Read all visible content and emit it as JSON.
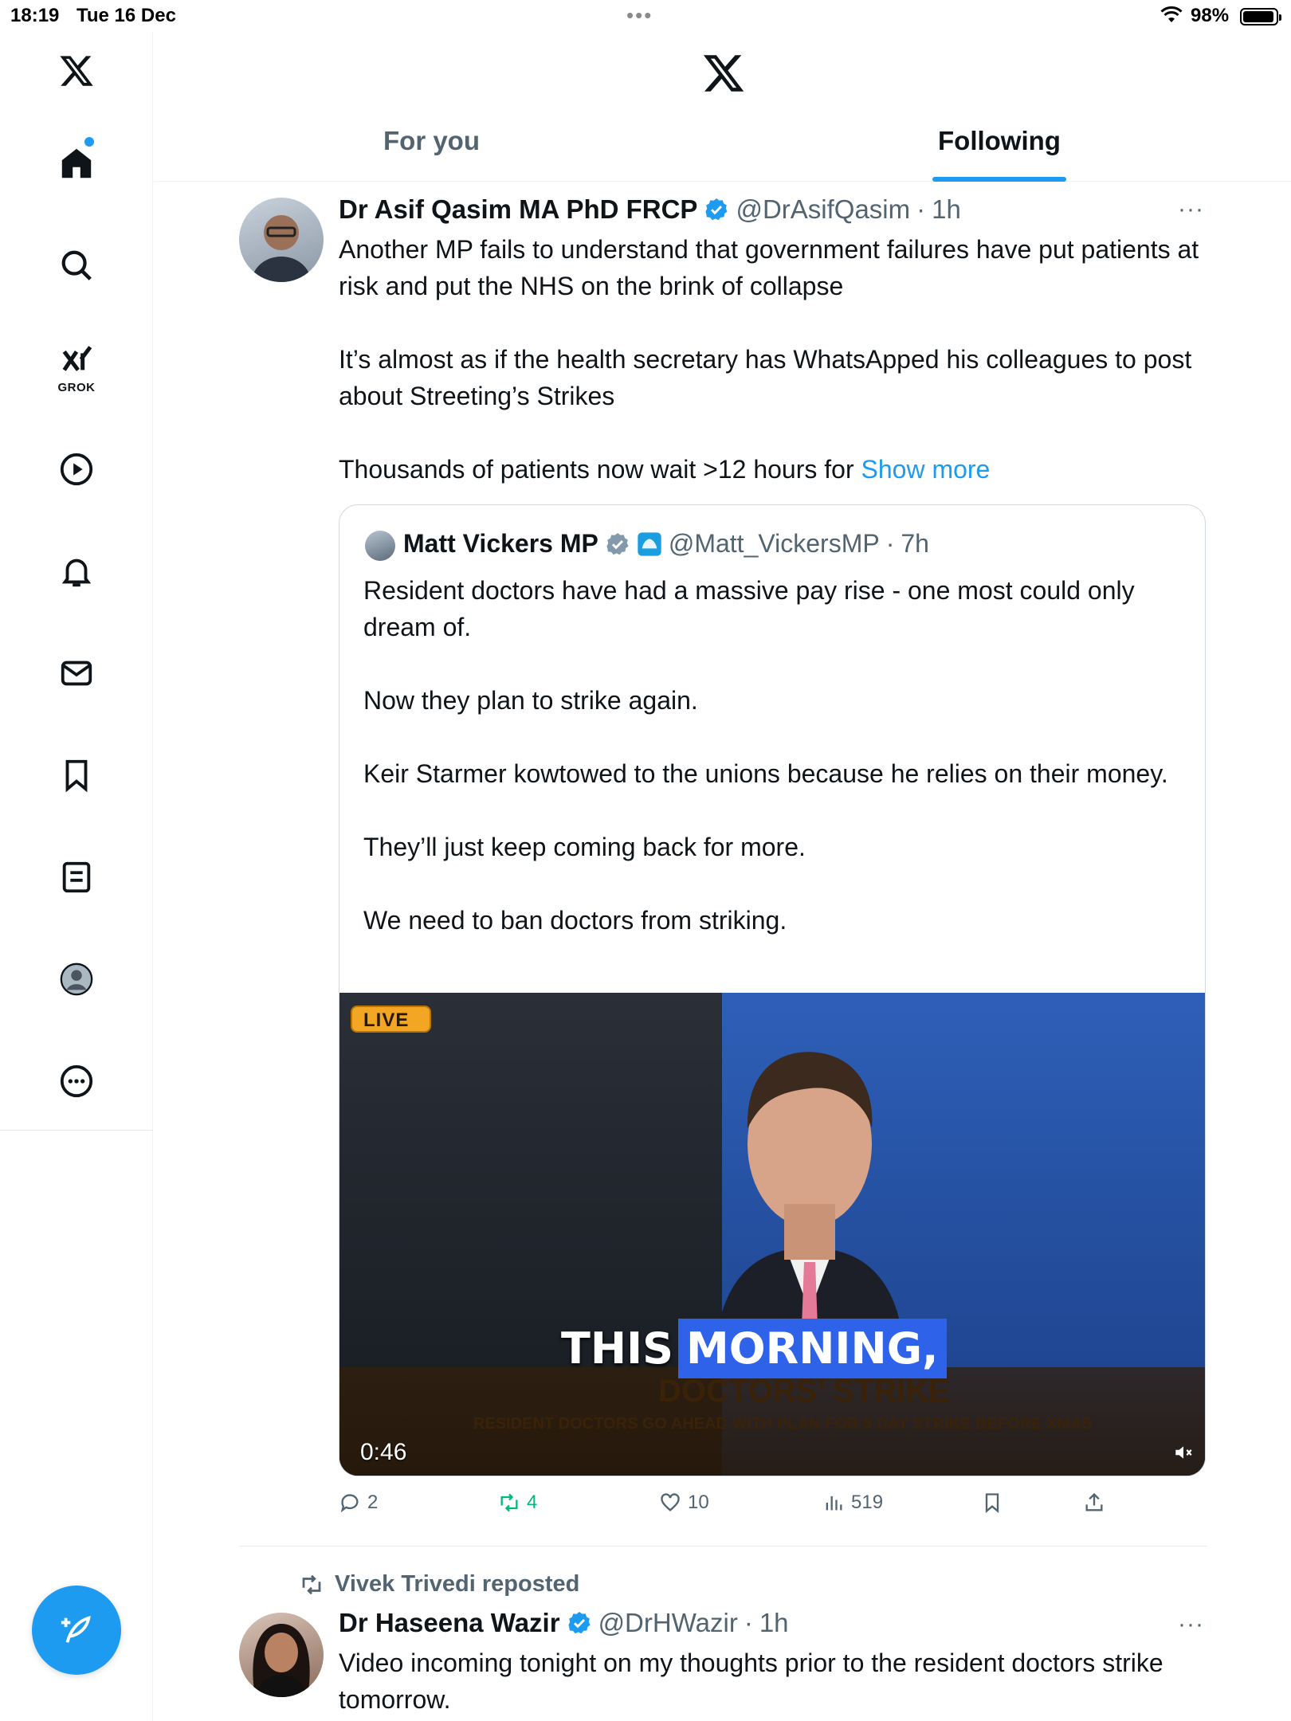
{
  "status_bar": {
    "time": "18:19",
    "date": "Tue 16 Dec",
    "multitask": "•••",
    "battery": "98%"
  },
  "sidebar": {
    "items": [
      {
        "name": "x-logo-icon"
      },
      {
        "name": "home-icon"
      },
      {
        "name": "search-icon"
      },
      {
        "name": "grok-icon",
        "label": "GROK"
      },
      {
        "name": "video-icon"
      },
      {
        "name": "notifications-icon"
      },
      {
        "name": "messages-icon"
      },
      {
        "name": "bookmarks-icon"
      },
      {
        "name": "lists-icon"
      },
      {
        "name": "profile-icon"
      },
      {
        "name": "more-icon"
      }
    ],
    "compose_icon": "compose-icon"
  },
  "header": {
    "tabs": [
      {
        "label": "For you",
        "active": false
      },
      {
        "label": "Following",
        "active": true
      }
    ],
    "accent": "#1d9bf0"
  },
  "tweets": [
    {
      "author": "Dr Asif Qasim MA PhD FRCP",
      "handle": "@DrAsifQasim",
      "sep": "·",
      "time": "1h",
      "more": "···",
      "text": "Another MP fails to understand that government failures have put patients at risk and put the NHS on the brink of collapse\n\nIt’s almost as if the health secretary has WhatsApped his colleagues to post about Streeting’s Strikes\n\nThousands of patients now wait >12 hours for ",
      "show_more": "Show more",
      "quote": {
        "author": "Matt Vickers MP",
        "handle": "@Matt_VickersMP",
        "sep": "·",
        "time": "7h",
        "text": "Resident doctors have had a massive pay rise - one most could only dream of.\n\nNow they plan to strike again.\n\nKeir Starmer kowtowed to the unions because he relies on their money.\n\nThey’ll just keep coming back for more.\n\nWe need to ban doctors from striking.",
        "video": {
          "live_badge": "LIVE",
          "caption_word1": "THIS",
          "caption_word2": "MORNING,",
          "lower_third_head": "DOCTORS’ STRIKE",
          "lower_third_sub": "RESIDENT DOCTORS GO AHEAD WITH PLAN FOR 5 DAY STRIKE BEFORE XMAS",
          "duration": "0:46"
        }
      },
      "actions": {
        "replies": "2",
        "reposts": "4",
        "likes": "10",
        "views": "519"
      }
    },
    {
      "repost_by": "Vivek Trivedi reposted",
      "author": "Dr Haseena Wazir",
      "handle": "@DrHWazir",
      "sep": "·",
      "time": "1h",
      "more": "···",
      "text": "Video incoming tonight on my thoughts prior to the resident doctors strike tomorrow."
    }
  ]
}
